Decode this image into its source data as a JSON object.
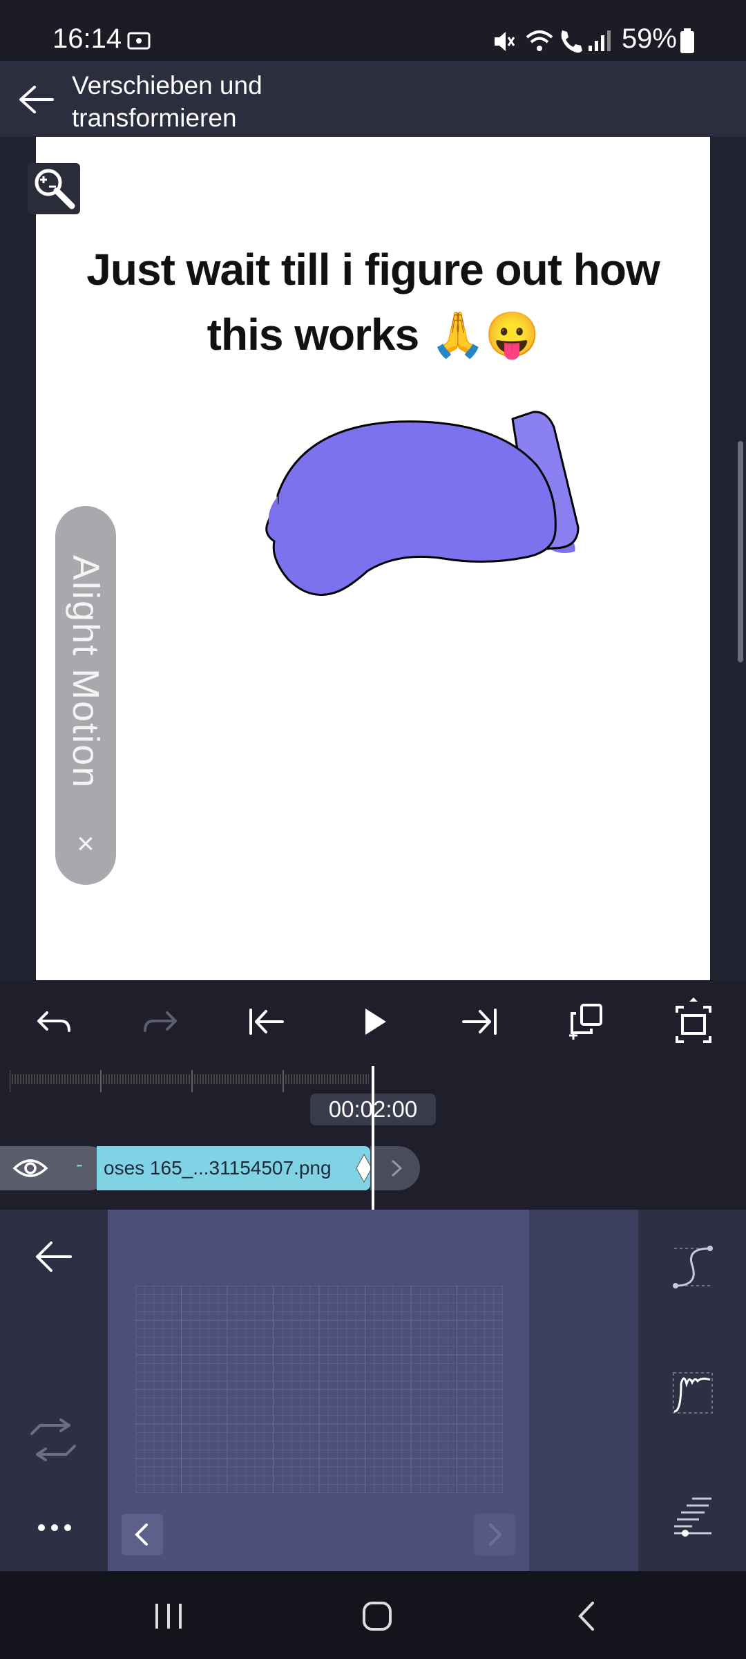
{
  "status_bar": {
    "time": "16:14",
    "battery": "59%"
  },
  "header": {
    "title_line1": "Verschieben und",
    "title_line2": "transformieren"
  },
  "preview": {
    "meme_text_line1": "Just wait till i figure out how",
    "meme_text_line2": "this works 🙏😛",
    "watermark": "Alight Motion",
    "watermark_close": "×",
    "blob_color": "#7d72ee"
  },
  "timeline": {
    "timecode": "00:02:00",
    "clip_label": "oses 165_...31154507.png",
    "clip_color": "#7fd3e5"
  },
  "icons": {
    "zoom": "zoom-out-icon",
    "undo": "undo-icon",
    "redo": "redo-icon",
    "jump_start": "jump-to-start-icon",
    "play": "play-icon",
    "jump_end": "jump-to-end-icon",
    "add_layer": "duplicate-icon",
    "fullscreen": "fullscreen-icon"
  }
}
